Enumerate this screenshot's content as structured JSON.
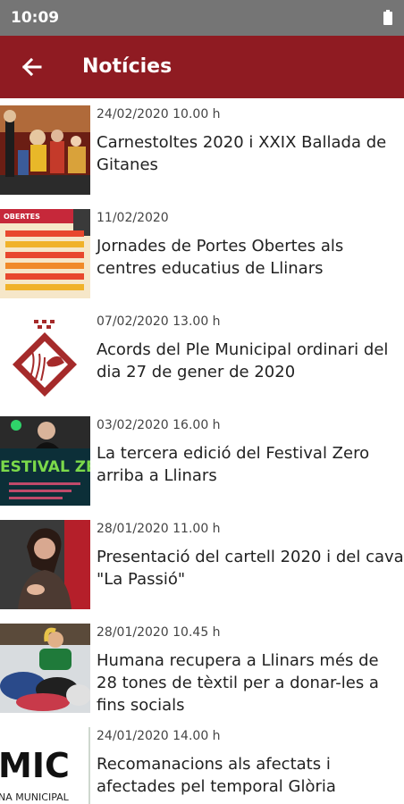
{
  "status_bar": {
    "time": "10:09"
  },
  "app_bar": {
    "title": "Notícies",
    "back_icon": "arrow-back-icon"
  },
  "thumb_texts": {
    "festival": "ESTIVAL ZER",
    "mic": "MIC",
    "municipal": "NA MUNICIPAL",
    "obertes": "OBERTES"
  },
  "news": [
    {
      "date": "24/02/2020 10.00 h",
      "title": "Carnestoltes 2020 i XXIX Ballada de Gitanes"
    },
    {
      "date": "11/02/2020",
      "title": "Jornades de Portes Obertes als centres educatius de Llinars"
    },
    {
      "date": "07/02/2020 13.00 h",
      "title": "Acords del Ple Municipal ordinari del dia 27 de gener de 2020"
    },
    {
      "date": "03/02/2020 16.00 h",
      "title": "La tercera edició del Festival Zero arriba a Llinars"
    },
    {
      "date": "28/01/2020 11.00 h",
      "title": "Presentació del cartell 2020 i del cava \"La Passió\""
    },
    {
      "date": "28/01/2020 10.45 h",
      "title": "Humana recupera a Llinars més de 28 tones de tèxtil per a donar-les a fins socials"
    },
    {
      "date": "24/01/2020 14.00 h",
      "title": "Recomanacions als afectats i afectades pel temporal Glòria"
    }
  ],
  "colors": {
    "app_bar": "#8f1b22",
    "status_bar": "#757575"
  }
}
